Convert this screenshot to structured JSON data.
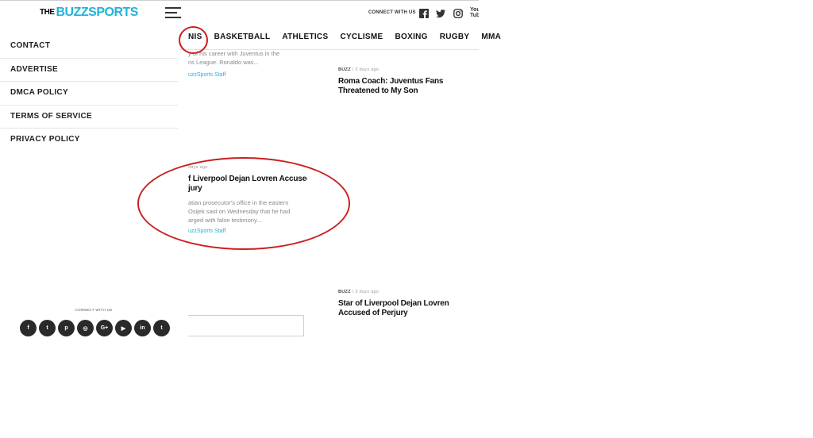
{
  "header": {
    "logo_the": "THE",
    "logo_buzz": "BUZZ",
    "logo_sports": "SPORTS",
    "connect_label": "CONNECT WITH US",
    "youtube_text": "You Tube"
  },
  "nav": {
    "items": [
      "NIS",
      "BASKETBALL",
      "ATHLETICS",
      "CYCLISME",
      "BOXING",
      "RUGBY",
      "MMA"
    ]
  },
  "side_menu": {
    "items": [
      "CONTACT",
      "ADVERTISE",
      "DMCA POLICY",
      "TERMS OF SERVICE",
      "PRIVACY POLICY"
    ]
  },
  "footer_left": {
    "connect_label": "CONNECT WITH US",
    "socials": [
      {
        "icon": "facebook-icon",
        "glyph": "f"
      },
      {
        "icon": "twitter-icon",
        "glyph": "t"
      },
      {
        "icon": "pinterest-icon",
        "glyph": "p"
      },
      {
        "icon": "instagram-icon",
        "glyph": "◎"
      },
      {
        "icon": "google-plus-icon",
        "glyph": "G+"
      },
      {
        "icon": "youtube-icon",
        "glyph": "▶"
      },
      {
        "icon": "linkedin-icon",
        "glyph": "in"
      },
      {
        "icon": "tumblr-icon",
        "glyph": "t"
      }
    ]
  },
  "articles": {
    "a1": {
      "excerpt_line1": "y of his career with Juventus in the",
      "excerpt_line2": "ns League. Ronaldo was...",
      "author": "uzzSports Staff"
    },
    "a2": {
      "category": "BUZZ",
      "time": "/ 2 days ago",
      "headline": "Roma Coach: Juventus Fans Threatened to My Son"
    },
    "a3": {
      "time": "days ago",
      "headline_line1": "f Liverpool Dejan Lovren Accused",
      "headline_line2": "jury",
      "excerpt_line1": "atian prosecutor's office in the eastern",
      "excerpt_line2": "Osijek said on Wednesday that he had",
      "excerpt_line3": "arged with false testimony...",
      "author": "uzzSports Staff"
    },
    "a4": {
      "category": "BUZZ",
      "time": "/ 3 days ago",
      "headline": "Star of Liverpool Dejan Lovren Accused of Perjury"
    }
  },
  "colors": {
    "accent": "#22b3d9",
    "annotation": "#cc1f1f"
  }
}
